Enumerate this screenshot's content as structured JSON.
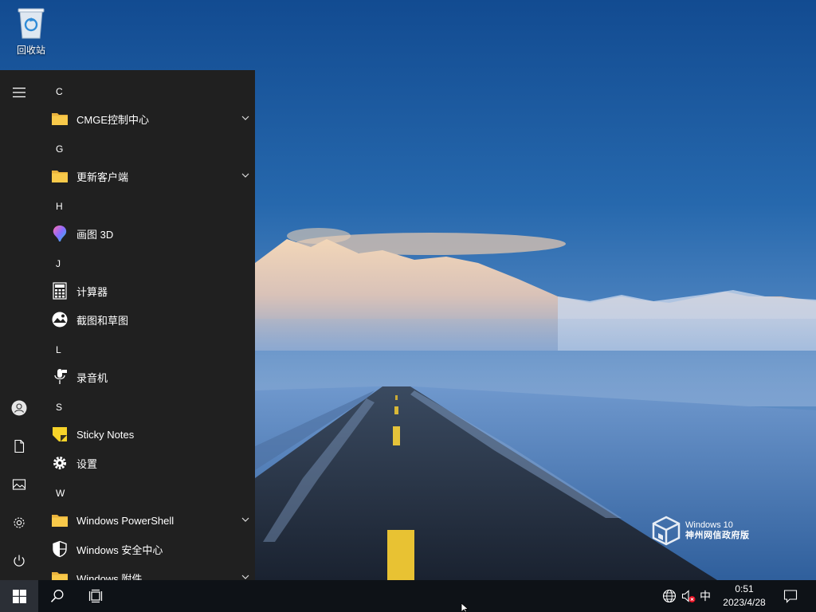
{
  "desktop": {
    "recycle_bin_label": "回收站",
    "watermark_line1": "Windows 10",
    "watermark_line2": "神州网信政府版"
  },
  "start_menu": {
    "rail": {
      "icons": [
        "hamburger-icon",
        "user-icon",
        "document-icon",
        "pictures-icon",
        "gear-icon",
        "power-icon"
      ]
    },
    "groups": [
      {
        "letter": "C",
        "apps": [
          {
            "label": "CMGE控制中心",
            "icon": "folder-icon",
            "expandable": true
          }
        ]
      },
      {
        "letter": "G",
        "apps": [
          {
            "label": "更新客户端",
            "icon": "folder-icon",
            "expandable": true
          }
        ]
      },
      {
        "letter": "H",
        "apps": [
          {
            "label": "画图 3D",
            "icon": "paint3d-icon",
            "expandable": false
          }
        ]
      },
      {
        "letter": "J",
        "apps": [
          {
            "label": "计算器",
            "icon": "calculator-icon",
            "expandable": false
          },
          {
            "label": "截图和草图",
            "icon": "snip-sketch-icon",
            "expandable": false
          }
        ]
      },
      {
        "letter": "L",
        "apps": [
          {
            "label": "录音机",
            "icon": "voice-recorder-icon",
            "expandable": false
          }
        ]
      },
      {
        "letter": "S",
        "apps": [
          {
            "label": "Sticky Notes",
            "icon": "sticky-notes-icon",
            "expandable": false
          },
          {
            "label": "设置",
            "icon": "gear-icon",
            "expandable": false
          }
        ]
      },
      {
        "letter": "W",
        "apps": [
          {
            "label": "Windows PowerShell",
            "icon": "folder-icon",
            "expandable": true
          },
          {
            "label": "Windows 安全中心",
            "icon": "shield-icon",
            "expandable": false
          },
          {
            "label": "Windows 附件",
            "icon": "folder-icon",
            "expandable": true
          }
        ]
      }
    ]
  },
  "taskbar": {
    "start_icon": "windows-logo-icon",
    "search_icon": "search-icon",
    "task_view_icon": "task-view-icon",
    "tray": {
      "network_icon": "globe-icon",
      "volume_icon": "volume-muted-icon",
      "ime_label": "中",
      "time": "0:51",
      "date": "2023/4/28",
      "notification_icon": "notification-icon"
    }
  },
  "colors": {
    "menu_bg": "#202020",
    "taskbar_bg": "#0e1217",
    "folder_yellow": "#f8c94a",
    "muted_red": "#e81123"
  }
}
